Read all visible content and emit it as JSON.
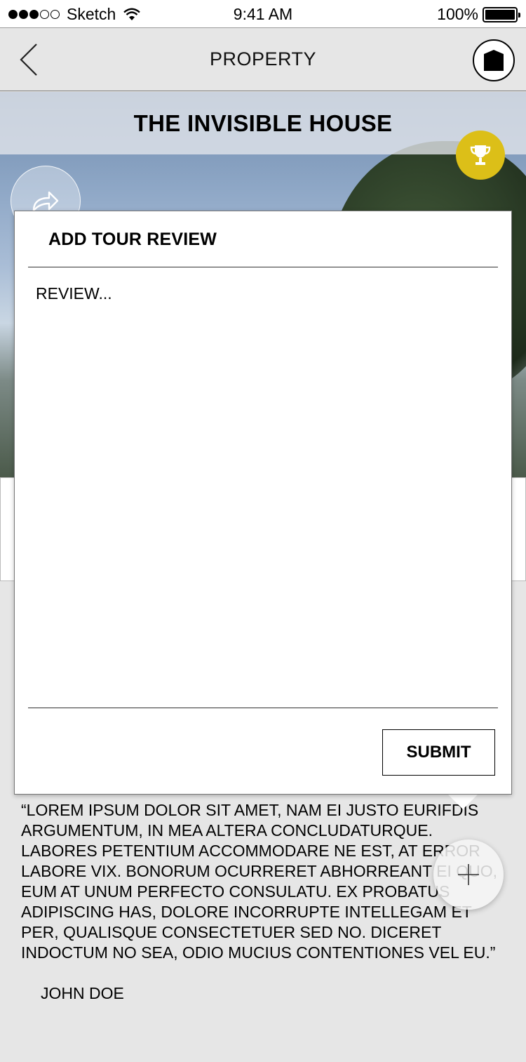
{
  "status_bar": {
    "carrier": "Sketch",
    "time": "9:41 AM",
    "battery": "100%",
    "battery_level": 1.0
  },
  "nav": {
    "title": "PROPERTY"
  },
  "hero": {
    "title": "THE INVISIBLE HOUSE"
  },
  "modal": {
    "title": "ADD TOUR REVIEW",
    "review_placeholder": "REVIEW...",
    "submit_label": "SUBMIT"
  },
  "review": {
    "quote": "“Lorem ipsum dolor sit amet, nam ei justo eurifdis argumentum, in mea altera concludaturque. Labores petentium accommodare ne est, at error labore vix. Bonorum ocurreret abhorreant ei quo, eum at unum perfecto consulatu. Ex probatus adipiscing has, dolore incorrupte intellegam et per, qualisque consectetuer sed no. Diceret indoctum no sea, odio mucius contentiones vel eu.”",
    "author": "JOHN DOE"
  },
  "colors": {
    "accent": "#dcbf18",
    "background": "#e6e6e6"
  },
  "icons": {
    "back": "chevron-left-icon",
    "logo": "logo-icon",
    "trophy": "trophy-icon",
    "share": "share-icon",
    "add": "plus-icon"
  }
}
